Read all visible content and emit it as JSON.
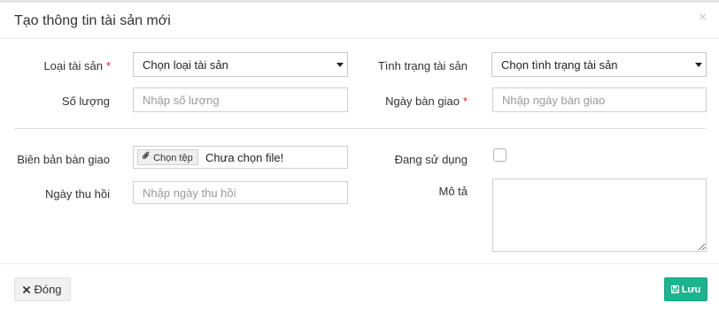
{
  "dialog": {
    "title": "Tạo thông tin tài sản mới",
    "close_icon": "×"
  },
  "form": {
    "asset_type": {
      "label": "Loại tài sản",
      "required_mark": "*",
      "selected": "Chọn loại tài sản"
    },
    "asset_status": {
      "label": "Tình trạng tài sản",
      "selected": "Chọn tình trạng tài sản"
    },
    "quantity": {
      "label": "Số lượng",
      "value": "",
      "placeholder": "Nhập số lượng"
    },
    "handover_date": {
      "label": "Ngày bàn giao",
      "required_mark": "*",
      "value": "",
      "placeholder": "Nhập ngày bàn giao"
    },
    "handover_record": {
      "label": "Biên bản bàn giao",
      "button_label": "Chọn tệp",
      "file_status": "Chưa chọn file!"
    },
    "in_use": {
      "label": "Đang sử dụng",
      "checked": false
    },
    "recall_date": {
      "label": "Ngày thu hồi",
      "value": "",
      "placeholder": "Nhập ngày thu hồi"
    },
    "description": {
      "label": "Mô tả",
      "value": ""
    }
  },
  "footer": {
    "close_label": "Đóng",
    "save_label": "Lưu"
  },
  "icons": {
    "close_button_icon": "times-icon",
    "save_button_icon": "floppy-disk-icon",
    "file_button_icon": "paperclip-icon"
  },
  "colors": {
    "required": "#e02424",
    "save_button": "#1eb38f"
  }
}
